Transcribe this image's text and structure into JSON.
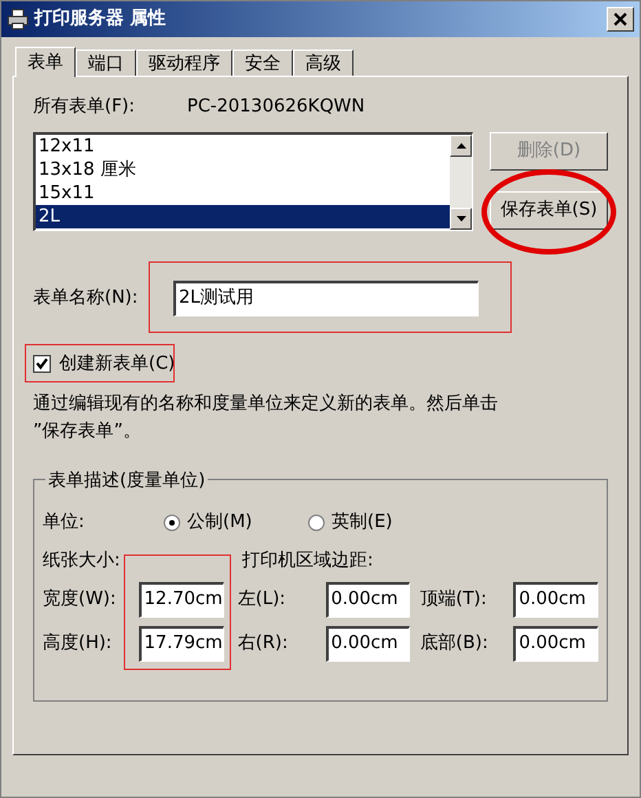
{
  "window": {
    "title": "打印服务器 属性"
  },
  "tabs": [
    {
      "label": "表单",
      "selected": true
    },
    {
      "label": "端口",
      "selected": false
    },
    {
      "label": "驱动程序",
      "selected": false
    },
    {
      "label": "安全",
      "selected": false
    },
    {
      "label": "高级",
      "selected": false
    }
  ],
  "forms_label": "所有表单(F):",
  "server_name": "PC-20130626KQWN",
  "form_list": [
    {
      "label": "12x11",
      "selected": false
    },
    {
      "label": "13x18 厘米",
      "selected": false
    },
    {
      "label": "15x11",
      "selected": false
    },
    {
      "label": "2L",
      "selected": true
    }
  ],
  "buttons": [
    {
      "label": "删除(D)",
      "disabled": true,
      "circled": false
    },
    {
      "label": "保存表单(S)",
      "disabled": false,
      "circled": true
    }
  ],
  "form_name": {
    "label": "表单名称(N):",
    "value": "2L测试用",
    "highlighted": true
  },
  "create_new": {
    "label": "创建新表单(C)",
    "checked": true,
    "highlighted": true
  },
  "description": "通过编辑现有的名称和度量单位来定义新的表单。然后单击 ”保存表单”。",
  "group": {
    "title": "表单描述(度量单位)",
    "units_label": "单位:",
    "units": [
      {
        "label": "公制(M)",
        "selected": true
      },
      {
        "label": "英制(E)",
        "selected": false
      }
    ],
    "paper_size_label": "纸张大小:",
    "margins_label": "打印机区域边距:",
    "size_highlighted": true,
    "rows": [
      {
        "label": "宽度(W):",
        "value": "12.70cm",
        "margin_label": "左(L):",
        "margin_value": "0.00cm",
        "margin2_label": "顶端(T):",
        "margin2_value": "0.00cm"
      },
      {
        "label": "高度(H):",
        "value": "17.79cm",
        "margin_label": "右(R):",
        "margin_value": "0.00cm",
        "margin2_label": "底部(B):",
        "margin2_value": "0.00cm"
      }
    ]
  }
}
